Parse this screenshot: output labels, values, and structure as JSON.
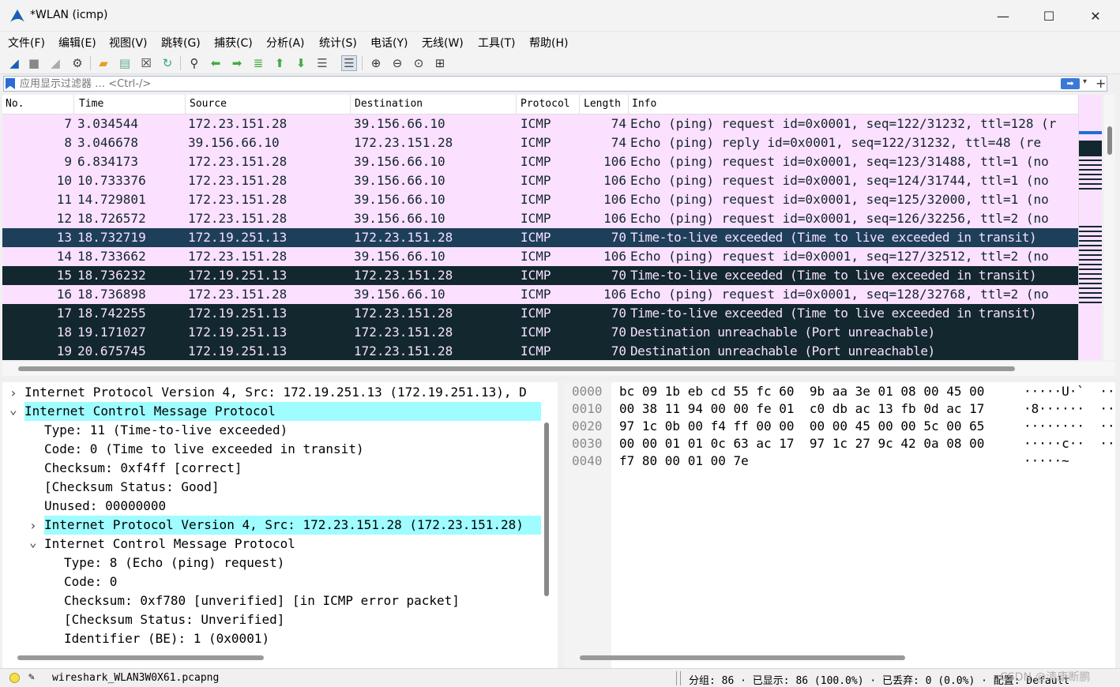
{
  "window": {
    "title": "*WLAN (icmp)",
    "minimize": "—",
    "maximize": "☐",
    "close": "✕"
  },
  "menu": [
    "文件(F)",
    "编辑(E)",
    "视图(V)",
    "跳转(G)",
    "捕获(C)",
    "分析(A)",
    "统计(S)",
    "电话(Y)",
    "无线(W)",
    "工具(T)",
    "帮助(H)"
  ],
  "toolbar_icons": [
    "shark-start-icon",
    "stop-icon",
    "restart-icon",
    "options-gear-icon",
    "open-folder-icon",
    "file-icon",
    "close-file-icon",
    "reload-icon",
    "find-icon",
    "back-arrow-icon",
    "forward-arrow-icon",
    "goto-packet-icon",
    "first-packet-icon",
    "last-packet-icon",
    "autoscroll-icon",
    "colorize-icon",
    "zoom-in-icon",
    "zoom-out-icon",
    "zoom-normal-icon",
    "resize-columns-icon"
  ],
  "filter": {
    "placeholder": "应用显示过滤器 … <Ctrl-/>",
    "apply_glyph": "➡",
    "dropdown_glyph": "▾",
    "add_glyph": "+"
  },
  "columns": {
    "no": "No.",
    "time": "Time",
    "source": "Source",
    "destination": "Destination",
    "protocol": "Protocol",
    "length": "Length",
    "info": "Info"
  },
  "packets": [
    {
      "no": "7",
      "time": "3.034544",
      "src": "172.23.151.28",
      "dst": "39.156.66.10",
      "proto": "ICMP",
      "len": "74",
      "info": "Echo (ping) request  id=0x0001, seq=122/31232, ttl=128 (r",
      "kind": "echo"
    },
    {
      "no": "8",
      "time": "3.046678",
      "src": "39.156.66.10",
      "dst": "172.23.151.28",
      "proto": "ICMP",
      "len": "74",
      "info": "Echo (ping) reply    id=0x0001, seq=122/31232, ttl=48 (re",
      "kind": "echo"
    },
    {
      "no": "9",
      "time": "6.834173",
      "src": "172.23.151.28",
      "dst": "39.156.66.10",
      "proto": "ICMP",
      "len": "106",
      "info": "Echo (ping) request  id=0x0001, seq=123/31488, ttl=1 (no",
      "kind": "echo"
    },
    {
      "no": "10",
      "time": "10.733376",
      "src": "172.23.151.28",
      "dst": "39.156.66.10",
      "proto": "ICMP",
      "len": "106",
      "info": "Echo (ping) request  id=0x0001, seq=124/31744, ttl=1 (no",
      "kind": "echo"
    },
    {
      "no": "11",
      "time": "14.729801",
      "src": "172.23.151.28",
      "dst": "39.156.66.10",
      "proto": "ICMP",
      "len": "106",
      "info": "Echo (ping) request  id=0x0001, seq=125/32000, ttl=1 (no",
      "kind": "echo"
    },
    {
      "no": "12",
      "time": "18.726572",
      "src": "172.23.151.28",
      "dst": "39.156.66.10",
      "proto": "ICMP",
      "len": "106",
      "info": "Echo (ping) request  id=0x0001, seq=126/32256, ttl=2 (no",
      "kind": "echo"
    },
    {
      "no": "13",
      "time": "18.732719",
      "src": "172.19.251.13",
      "dst": "172.23.151.28",
      "proto": "ICMP",
      "len": "70",
      "info": "Time-to-live exceeded (Time to live exceeded in transit)",
      "kind": "ttl sel"
    },
    {
      "no": "14",
      "time": "18.733662",
      "src": "172.23.151.28",
      "dst": "39.156.66.10",
      "proto": "ICMP",
      "len": "106",
      "info": "Echo (ping) request  id=0x0001, seq=127/32512, ttl=2 (no",
      "kind": "echo"
    },
    {
      "no": "15",
      "time": "18.736232",
      "src": "172.19.251.13",
      "dst": "172.23.151.28",
      "proto": "ICMP",
      "len": "70",
      "info": "Time-to-live exceeded (Time to live exceeded in transit)",
      "kind": "ttl"
    },
    {
      "no": "16",
      "time": "18.736898",
      "src": "172.23.151.28",
      "dst": "39.156.66.10",
      "proto": "ICMP",
      "len": "106",
      "info": "Echo (ping) request  id=0x0001, seq=128/32768, ttl=2 (no",
      "kind": "echo"
    },
    {
      "no": "17",
      "time": "18.742255",
      "src": "172.19.251.13",
      "dst": "172.23.151.28",
      "proto": "ICMP",
      "len": "70",
      "info": "Time-to-live exceeded (Time to live exceeded in transit)",
      "kind": "ttl"
    },
    {
      "no": "18",
      "time": "19.171027",
      "src": "172.19.251.13",
      "dst": "172.23.151.28",
      "proto": "ICMP",
      "len": "70",
      "info": "Destination unreachable (Port unreachable)",
      "kind": "ttl"
    },
    {
      "no": "19",
      "time": "20.675745",
      "src": "172.19.251.13",
      "dst": "172.23.151.28",
      "proto": "ICMP",
      "len": "70",
      "info": "Destination unreachable (Port unreachable)",
      "kind": "ttl"
    }
  ],
  "details": [
    {
      "text": "Internet Protocol Version 4, Src: 172.19.251.13 (172.19.251.13), D",
      "indent": 0,
      "arrow": "right",
      "hl": false
    },
    {
      "text": "Internet Control Message Protocol",
      "indent": 0,
      "arrow": "down",
      "hl": true
    },
    {
      "text": "Type: 11 (Time-to-live exceeded)",
      "indent": 1,
      "arrow": "",
      "hl": false
    },
    {
      "text": "Code: 0 (Time to live exceeded in transit)",
      "indent": 1,
      "arrow": "",
      "hl": false
    },
    {
      "text": "Checksum: 0xf4ff [correct]",
      "indent": 1,
      "arrow": "",
      "hl": false
    },
    {
      "text": "[Checksum Status: Good]",
      "indent": 1,
      "arrow": "",
      "hl": false
    },
    {
      "text": "Unused: 00000000",
      "indent": 1,
      "arrow": "",
      "hl": false
    },
    {
      "text": "Internet Protocol Version 4, Src: 172.23.151.28 (172.23.151.28)",
      "indent": 1,
      "arrow": "right",
      "hl": true
    },
    {
      "text": "Internet Control Message Protocol",
      "indent": 1,
      "arrow": "down",
      "hl": false
    },
    {
      "text": "Type: 8 (Echo (ping) request)",
      "indent": 2,
      "arrow": "",
      "hl": false
    },
    {
      "text": "Code: 0",
      "indent": 2,
      "arrow": "",
      "hl": false
    },
    {
      "text": "Checksum: 0xf780 [unverified] [in ICMP error packet]",
      "indent": 2,
      "arrow": "",
      "hl": false
    },
    {
      "text": "[Checksum Status: Unverified]",
      "indent": 2,
      "arrow": "",
      "hl": false
    },
    {
      "text": "Identifier (BE): 1 (0x0001)",
      "indent": 2,
      "arrow": "",
      "hl": false
    }
  ],
  "hex": [
    {
      "offset": "0000",
      "bytes": "bc 09 1b eb cd 55 fc 60  9b aa 3e 01 08 00 45 00",
      "ascii": "·····U·`  ··>···E·"
    },
    {
      "offset": "0010",
      "bytes": "00 38 11 94 00 00 fe 01  c0 db ac 13 fb 0d ac 17",
      "ascii": "·8······  ········"
    },
    {
      "offset": "0020",
      "bytes": "97 1c 0b 00 f4 ff 00 00  00 00 45 00 00 5c 00 65",
      "ascii": "········  ··E··\\·e"
    },
    {
      "offset": "0030",
      "bytes": "00 00 01 01 0c 63 ac 17  97 1c 27 9c 42 0a 08 00",
      "ascii": "·····c··  ··'·B···"
    },
    {
      "offset": "0040",
      "bytes": "f7 80 00 01 00 7e",
      "ascii": "·····~"
    }
  ],
  "status": {
    "file": "wireshark_WLAN3W0X61.pcapng",
    "packets": "分组: 86  · 已显示: 86 (100.0%)  · 已丢弃: 0 (0.0%)  · 配置: Default",
    "watermark": "CSDN @清康断鹏"
  },
  "colors": {
    "echo_bg": "#fce0ff",
    "ttl_bg": "#12272e",
    "ttl_fg": "#f7e0ff",
    "selected_bg": "#1e3f5a",
    "highlight": "#9ffcff"
  }
}
